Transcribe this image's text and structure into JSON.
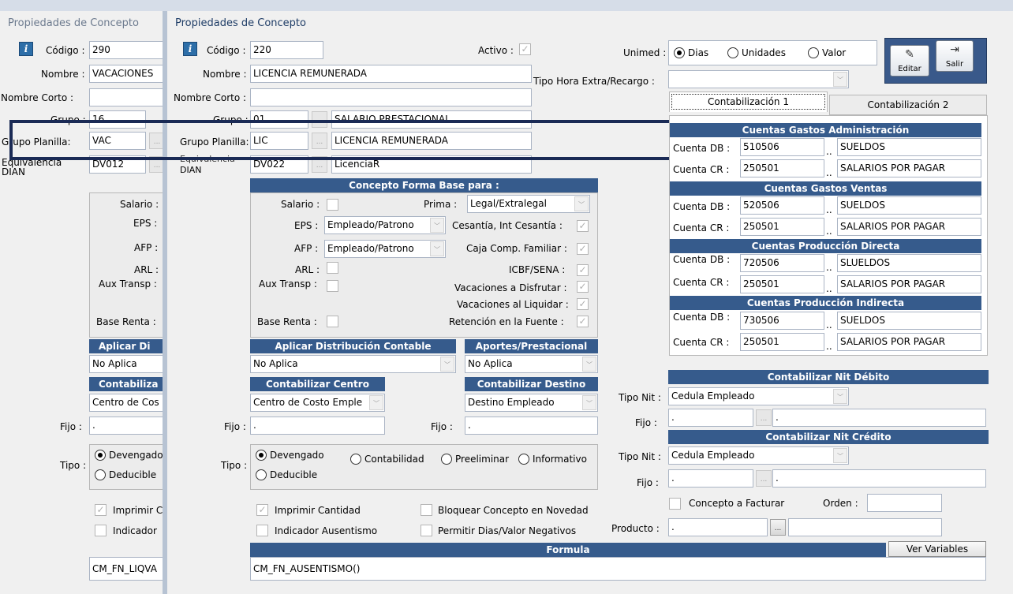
{
  "back_window": {
    "title": "Propiedades de Concepto",
    "codigo_label": "Código :",
    "codigo_value": "290",
    "nombre_label": "Nombre :",
    "nombre_value": "VACACIONES",
    "nombre_corto_label": "Nombre Corto :",
    "grupo_label": "Grupo :",
    "grupo_value": "16",
    "grupo_planilla_label": "Grupo Planilla:",
    "grupo_planilla_value": "VAC",
    "equivalencia_label": "Equivalencia DIAN",
    "equivalencia_value": "DV012",
    "salario_label": "Salario :",
    "eps_label": "EPS :",
    "afp_label": "AFP :",
    "arl_label": "ARL :",
    "aux_transp_label": "Aux Transp :",
    "base_renta_label": "Base Renta :",
    "aplicar_header": "Aplicar Di",
    "aplicar_value": "No Aplica",
    "contabilizar_header": "Contabiliza",
    "centro_value": "Centro de Cos",
    "fijo_label": "Fijo :",
    "fijo_value": ".",
    "tipo_label": "Tipo :",
    "devengado": "Devengado",
    "deducible": "Deducible",
    "imprimir": "Imprimir C",
    "indicador": "Indicador",
    "formula_value": "CM_FN_LIQVA"
  },
  "window": {
    "title": "Propiedades de Concepto",
    "codigo_label": "Código :",
    "codigo_value": "220",
    "activo_label": "Activo :",
    "nombre_label": "Nombre :",
    "nombre_value": "LICENCIA REMUNERADA",
    "nombre_corto_label": "Nombre Corto :",
    "grupo_label": "Grupo :",
    "grupo_value": "01",
    "grupo_desc": "SALARIO PRESTACIONAL",
    "grupo_planilla_label": "Grupo Planilla:",
    "grupo_planilla_value": "LIC",
    "grupo_planilla_desc": "LICENCIA REMUNERADA",
    "equivalencia_label_1": "Equivalencia",
    "equivalencia_label_2": "DIAN",
    "equivalencia_value": "DV022",
    "equivalencia_desc": "LicenciaR",
    "ellipsis": "...",
    "unimed_label": "Unimed :",
    "unimed_options": [
      "Dias",
      "Unidades",
      "Valor"
    ],
    "tipo_hora_label": "Tipo Hora Extra/Recargo :",
    "editar_label": "Editar",
    "salir_label": "Salir"
  },
  "base": {
    "header": "Concepto Forma Base para :",
    "salario_label": "Salario :",
    "prima_label": "Prima :",
    "prima_value": "Legal/Extralegal",
    "eps_label": "EPS :",
    "eps_value": "Empleado/Patrono",
    "cesantia_label": "Cesantía, Int Cesantía :",
    "afp_label": "AFP :",
    "afp_value": "Empleado/Patrono",
    "caja_label": "Caja Comp. Familiar :",
    "arl_label": "ARL :",
    "icbf_label": "ICBF/SENA :",
    "aux_label": "Aux Transp :",
    "vac_disfrutar_label": "Vacaciones a Disfrutar :",
    "vac_liquidar_label": "Vacaciones al Liquidar :",
    "base_renta_label": "Base Renta :",
    "retencion_label": "Retención en la Fuente :"
  },
  "distribucion": {
    "aplicar_header": "Aplicar Distribución Contable",
    "aplicar_value": "No Aplica",
    "aportes_header": "Aportes/Prestacional",
    "aportes_value": "No Aplica",
    "centro_header": "Contabilizar Centro",
    "centro_value": "Centro de Costo Emple",
    "destino_header": "Contabilizar Destino",
    "destino_value": "Destino Empleado",
    "fijo_label": "Fijo :",
    "fijo_value": ".",
    "fijo2_label": "Fijo :",
    "fijo2_value": "."
  },
  "tipo": {
    "label": "Tipo :",
    "options": [
      "Devengado",
      "Contabilidad",
      "Preeliminar",
      "Informativo",
      "Deducible"
    ]
  },
  "flags": {
    "imprimir_cantidad": "Imprimir Cantidad",
    "bloquear": "Bloquear Concepto en Novedad",
    "indicador": "Indicador Ausentismo",
    "permitir": "Permitir Dias/Valor Negativos"
  },
  "formula": {
    "header": "Formula",
    "value": "CM_FN_AUSENTISMO()",
    "ver_variables": "Ver Variables"
  },
  "tabs": [
    "Contabilización 1",
    "Contabilización 2"
  ],
  "cuentas": {
    "db_label": "Cuenta DB :",
    "cr_label": "Cuenta CR :",
    "dots": "..",
    "sections": [
      {
        "header": "Cuentas Gastos Administración",
        "db": "510506",
        "db_desc": "SUELDOS",
        "cr": "250501",
        "cr_desc": "SALARIOS POR PAGAR"
      },
      {
        "header": "Cuentas Gastos Ventas",
        "db": "520506",
        "db_desc": "SUELDOS",
        "cr": "250501",
        "cr_desc": "SALARIOS POR PAGAR"
      },
      {
        "header": "Cuentas Producción Directa",
        "db": "720506",
        "db_desc": "SLUELDOS",
        "cr": "250501",
        "cr_desc": "SALARIOS POR PAGAR"
      },
      {
        "header": "Cuentas Producción Indirecta",
        "db": "730506",
        "db_desc": "SUELDOS",
        "cr": "250501",
        "cr_desc": "SALARIOS POR PAGAR"
      }
    ]
  },
  "nit_debito": {
    "header": "Contabilizar Nit Débito",
    "tipo_label": "Tipo Nit :",
    "tipo_value": "Cedula Empleado",
    "fijo_label": "Fijo :",
    "fijo_value": ".",
    "fijo_desc": "."
  },
  "nit_credito": {
    "header": "Contabilizar Nit Crédito",
    "tipo_label": "Tipo Nit :",
    "tipo_value": "Cedula Empleado",
    "fijo_label": "Fijo :",
    "fijo_value": ".",
    "fijo_desc": "."
  },
  "facturar": {
    "concepto_label": "Concepto a Facturar",
    "orden_label": "Orden :",
    "producto_label": "Producto :",
    "producto_value": "."
  },
  "colors": {
    "header_bg": "#365b8c",
    "highlight_frame": "#1a2a55"
  }
}
